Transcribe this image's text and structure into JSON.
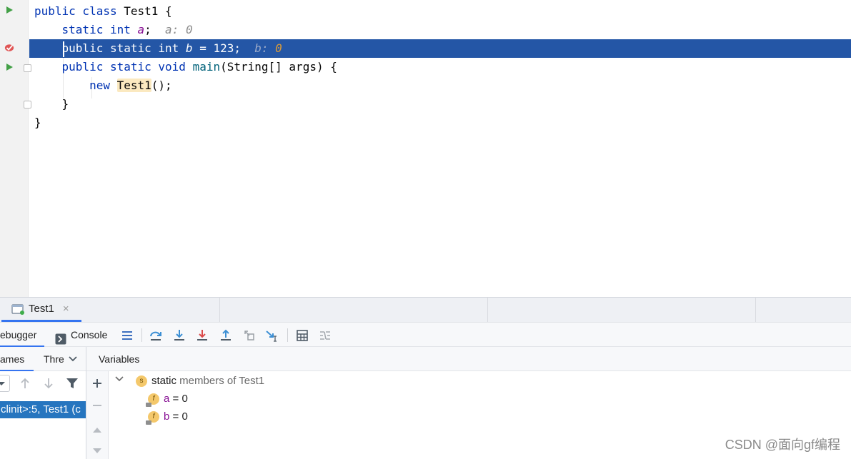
{
  "editor": {
    "lines": [
      {
        "parts": [
          {
            "t": "public class ",
            "c": "kw"
          },
          {
            "t": "Test1 {",
            "c": ""
          }
        ]
      },
      {
        "parts": [
          {
            "t": "    static int ",
            "c": "kw"
          },
          {
            "t": "a",
            "c": "ital"
          },
          {
            "t": ";",
            "c": ""
          },
          {
            "t": "  a: 0",
            "c": "hint"
          }
        ]
      },
      {
        "parts": [
          {
            "t": "    public static int ",
            "c": "kw"
          },
          {
            "t": "b",
            "c": "ital"
          },
          {
            "t": " = 123;",
            "c": ""
          },
          {
            "t": "  b: ",
            "c": "hint"
          },
          {
            "t": "0",
            "c": "hint-val"
          }
        ]
      },
      {
        "parts": [
          {
            "t": "    public static void ",
            "c": "kw"
          },
          {
            "t": "main",
            "c": "fn"
          },
          {
            "t": "(String[] args) {",
            "c": ""
          }
        ]
      },
      {
        "parts": [
          {
            "t": "        new ",
            "c": "kw"
          },
          {
            "t": "Test1",
            "c": "cls"
          },
          {
            "t": "();",
            "c": ""
          }
        ]
      },
      {
        "parts": [
          {
            "t": "    }",
            "c": ""
          }
        ]
      },
      {
        "parts": [
          {
            "t": "}",
            "c": ""
          }
        ]
      }
    ],
    "highlighted_line": 3
  },
  "run_tab": {
    "label": "Test1",
    "close": "×"
  },
  "toolbar": {
    "debugger_tab": "Debugger",
    "debugger_visible": "ebugger",
    "console_tab": "Console",
    "colors": {
      "step": "#3c8fd4",
      "force": "#db4a4a",
      "gray": "#8c8c8c"
    }
  },
  "frames": {
    "header_frames": "ames",
    "header_threads": "Thre",
    "selected_frame": "clinit>:5, Test1 (c"
  },
  "variables": {
    "header": "Variables",
    "group_prefix": "static",
    "group_rest": " members of Test1",
    "group_badge": "s",
    "items": [
      {
        "name": "a",
        "value": " = 0",
        "badge": "f"
      },
      {
        "name": "b",
        "value": " = 0",
        "badge": "f"
      }
    ]
  },
  "watermark": "CSDN @面向gf编程"
}
